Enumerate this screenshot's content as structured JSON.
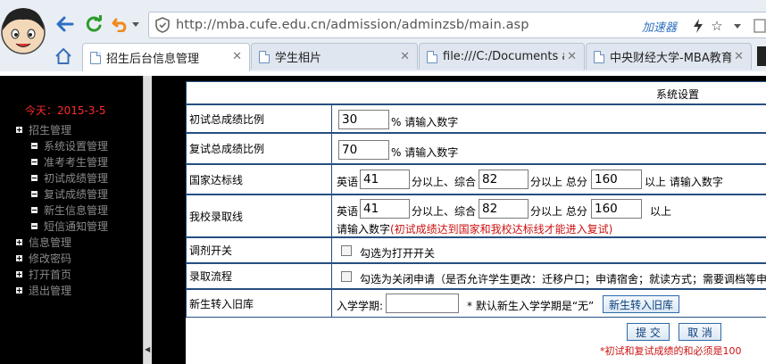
{
  "browser": {
    "url": "http://mba.cufe.edu.cn/admission/adminzsb/main.asp",
    "accelerator_label": "加速器",
    "tabs": [
      {
        "label": "招生后台信息管理",
        "active": true
      },
      {
        "label": "学生相片",
        "active": false
      },
      {
        "label": "file:///C:/Documents and",
        "active": false
      },
      {
        "label": "中央财经大学-MBA教育中",
        "active": false
      }
    ]
  },
  "sidebar": {
    "today": "今天：2015-3-5",
    "items": [
      {
        "label": "招生管理",
        "type": "plus"
      },
      {
        "label": "系统设置管理",
        "type": "minus"
      },
      {
        "label": "准考考生管理",
        "type": "minus"
      },
      {
        "label": "初试成绩管理",
        "type": "minus"
      },
      {
        "label": "复试成绩管理",
        "type": "minus"
      },
      {
        "label": "新生信息管理",
        "type": "minus"
      },
      {
        "label": "短信通知管理",
        "type": "minus"
      },
      {
        "label": "信息管理",
        "type": "plus"
      },
      {
        "label": "修改密码",
        "type": "plus"
      },
      {
        "label": "打开首页",
        "type": "plus"
      },
      {
        "label": "退出管理",
        "type": "plus"
      }
    ]
  },
  "form": {
    "title": "系统设置",
    "initial_ratio": {
      "label": "初试总成绩比例",
      "value": "30",
      "suffix": "% 请输入数字"
    },
    "retest_ratio": {
      "label": "复试总成绩比例",
      "value": "70",
      "suffix": "% 请输入数字"
    },
    "national_line": {
      "label": "国家达标线",
      "english_label": "英语",
      "english_value": "41",
      "english_suffix": "分以上、综合",
      "comprehensive_value": "82",
      "comprehensive_suffix": "分以上 总分",
      "total_value": "160",
      "total_suffix": "以上 请输入数字"
    },
    "school_line": {
      "label": "我校录取线",
      "english_label": "英语",
      "english_value": "41",
      "english_suffix": "分以上、综合",
      "comprehensive_value": "82",
      "comprehensive_suffix": "分以上 总分",
      "total_value": "160",
      "total_suffix": "以上",
      "hint": "请输入数字",
      "note": "(初试成绩达到国家和我校达标线才能进入复试)"
    },
    "adjust_switch": {
      "label": "调剂开关",
      "checkbox_text": "勾选为打开开关"
    },
    "admission_flow": {
      "label": "录取流程",
      "checkbox_text": "勾选为关闭申请（是否允许学生更改：迁移户口；申请宿舍；就读方式；需要调档等申"
    },
    "transfer": {
      "label": "新生转入旧库",
      "term_label": "入学学期:",
      "term_value": "",
      "default_note": "* 默认新生入学学期是“无”",
      "button": "新生转入旧库"
    },
    "submit": "提 交",
    "cancel": "取 消",
    "footer_note": "*初试和复试成绩的和必须是100"
  },
  "colors": {
    "accent_red": "#cc1111",
    "border_blue": "#264f80",
    "link_blue": "#2f6fc0"
  }
}
